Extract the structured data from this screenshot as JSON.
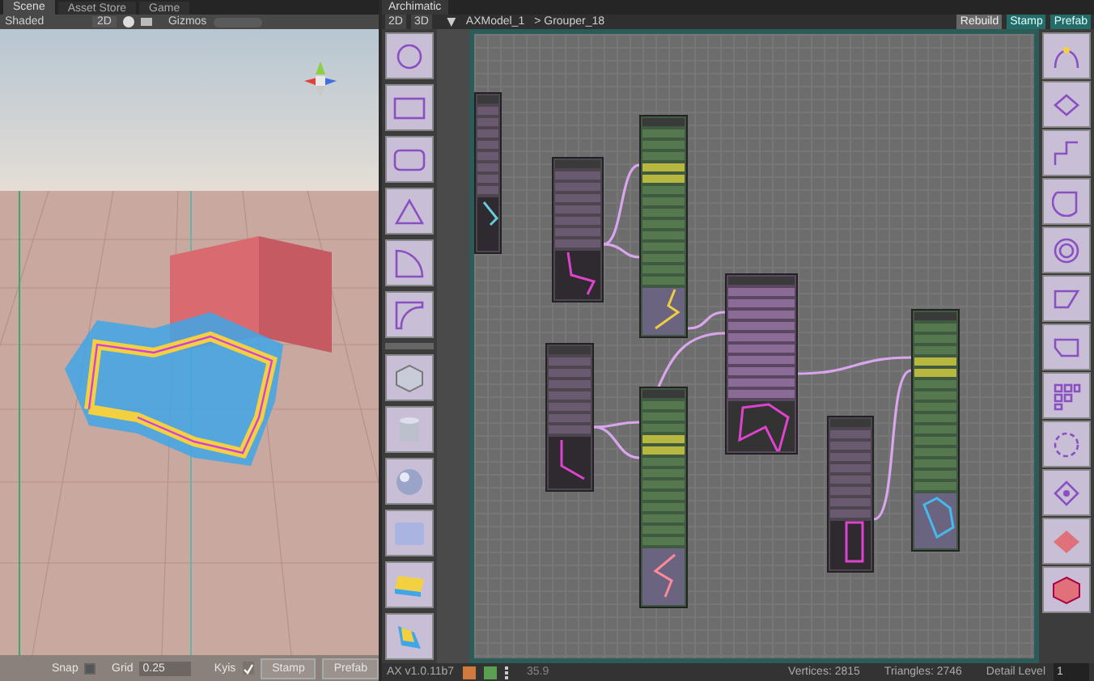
{
  "scene": {
    "tabs": [
      {
        "label": "Scene",
        "selected": true
      },
      {
        "label": "Asset Store",
        "selected": false
      },
      {
        "label": "Game",
        "selected": false
      }
    ],
    "toolbar": {
      "shading": "Shaded",
      "mode_2d": "2D",
      "gizmos": "Gizmos"
    },
    "bottom_bar": {
      "snap_label": "Snap",
      "snap_checked": false,
      "grid_label": "Grid",
      "grid_value": "0.25",
      "axis_label": "Kyis",
      "axis_checked": true,
      "buttons": [
        "Stamp",
        "Prefab"
      ]
    }
  },
  "archimatic": {
    "tab": "Archimatic",
    "toolbar": {
      "view_buttons": [
        {
          "label": "2D",
          "selected": false
        },
        {
          "label": "3D",
          "selected": false
        }
      ],
      "breadcrumb": [
        "AXModel_1",
        "> Grouper_18"
      ],
      "buttons": [
        {
          "label": "Rebuild",
          "kind": "plain"
        },
        {
          "label": "Stamp",
          "kind": "accent"
        },
        {
          "label": "Prefab",
          "kind": "accent"
        }
      ]
    },
    "nodes": [
      {
        "kind": "shape",
        "color": "#66ccdd"
      },
      {
        "kind": "shape",
        "color": "#dd44cc"
      },
      {
        "kind": "mesher",
        "color": "#eecc44"
      },
      {
        "kind": "combiner",
        "color": "#dd44cc"
      },
      {
        "kind": "shape",
        "color": "#dd44cc"
      },
      {
        "kind": "mesher",
        "color": "#ff8899"
      },
      {
        "kind": "shape",
        "color": "#dd44cc"
      },
      {
        "kind": "mesher",
        "color": "#44bbee"
      }
    ],
    "status_bar": {
      "version": "AX v1.0.11b7",
      "fps": "35.9",
      "vertices": "Vertices: 2815",
      "triangles": "Triangles: 2746",
      "detail_label": "Detail Level",
      "detail_value": "1"
    }
  }
}
